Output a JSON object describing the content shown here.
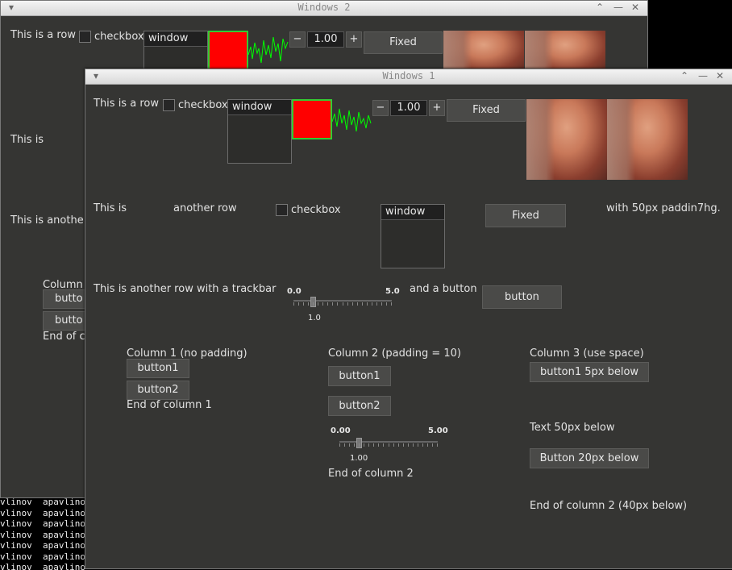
{
  "terminal": {
    "lines": [
      "vlinov  apavlino",
      "vlinov  apavlino",
      "vlinov  apavlino",
      "vlinov  apavlino",
      "vlinov  apavlino",
      "vlinov  apavlino",
      "vlinov  apavlino"
    ]
  },
  "win2": {
    "title": "Windows 2",
    "row1": {
      "text": "This is a row",
      "checkbox": "checkbox",
      "window_label": "window",
      "spin_value": "1.00",
      "minus": "−",
      "plus": "+",
      "fixed": "Fixed"
    },
    "row2_text": "This is",
    "row3_text": "This is anothe",
    "col1": {
      "title": "Column",
      "button1": "butto",
      "button2": "butto",
      "end": "End of c"
    }
  },
  "win1": {
    "title": "Windows 1",
    "row1": {
      "text": "This is a row",
      "checkbox": "checkbox",
      "window_label": "window",
      "spin_value": "1.00",
      "minus": "−",
      "plus": "+",
      "fixed": "Fixed"
    },
    "row2": {
      "text1": "This is",
      "text2": "another row",
      "checkbox": "checkbox",
      "window_label": "window",
      "fixed": "Fixed",
      "text3": "with 50px paddin7hg."
    },
    "row3": {
      "text": "This is another row with a trackbar",
      "min": "0.0",
      "max": "5.0",
      "value": "1.0",
      "value_num": 1.0,
      "text2": "and a button",
      "button": "button"
    },
    "col1": {
      "title": "Column 1 (no padding)",
      "button1": "button1",
      "button2": "button2",
      "end": "End of column 1"
    },
    "col2": {
      "title": "Column 2 (padding = 10)",
      "button1": "button1",
      "button2": "button2",
      "min": "0.00",
      "max": "5.00",
      "value": "1.00",
      "value_num": 1.0,
      "end": "End of column 2"
    },
    "col3": {
      "title": "Column 3 (use space)",
      "button1": "button1 5px below",
      "text": "Text 50px below",
      "button2": "Button 20px below",
      "end": "End of column 2 (40px below)"
    }
  },
  "colors": {
    "accent_red": "#ff0000",
    "plot_green": "#00ff00",
    "bg": "#353533"
  },
  "icons": [
    "menu-arrow-icon",
    "minimize-icon",
    "maximize-icon",
    "close-icon"
  ]
}
